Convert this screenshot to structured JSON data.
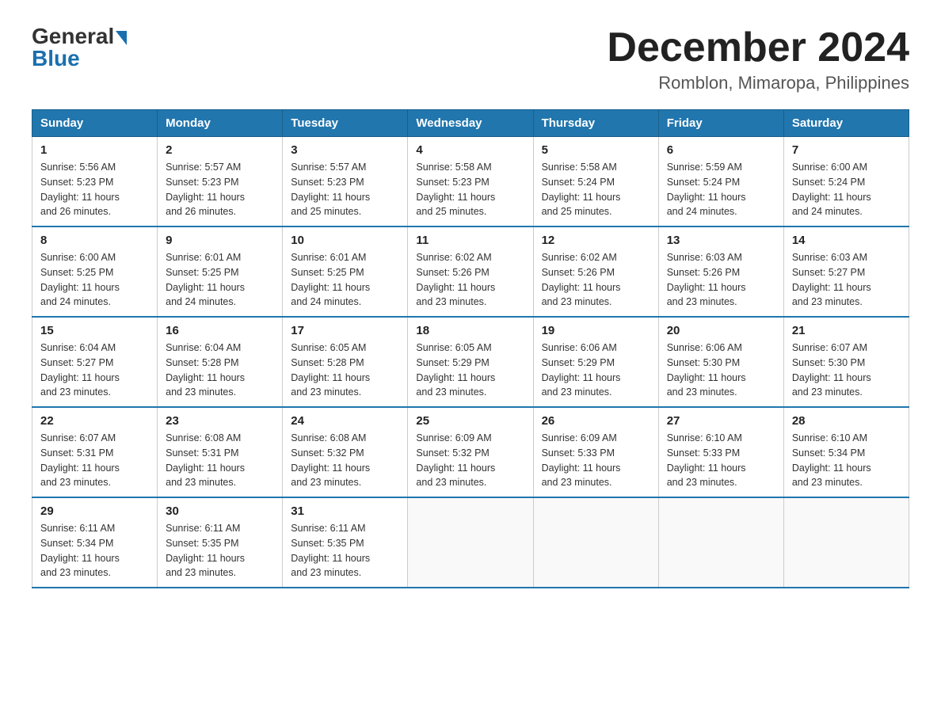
{
  "header": {
    "logo_general": "General",
    "logo_blue": "Blue",
    "month_title": "December 2024",
    "location": "Romblon, Mimaropa, Philippines"
  },
  "weekdays": [
    "Sunday",
    "Monday",
    "Tuesday",
    "Wednesday",
    "Thursday",
    "Friday",
    "Saturday"
  ],
  "weeks": [
    [
      {
        "day": "1",
        "sunrise": "5:56 AM",
        "sunset": "5:23 PM",
        "daylight": "11 hours and 26 minutes."
      },
      {
        "day": "2",
        "sunrise": "5:57 AM",
        "sunset": "5:23 PM",
        "daylight": "11 hours and 26 minutes."
      },
      {
        "day": "3",
        "sunrise": "5:57 AM",
        "sunset": "5:23 PM",
        "daylight": "11 hours and 25 minutes."
      },
      {
        "day": "4",
        "sunrise": "5:58 AM",
        "sunset": "5:23 PM",
        "daylight": "11 hours and 25 minutes."
      },
      {
        "day": "5",
        "sunrise": "5:58 AM",
        "sunset": "5:24 PM",
        "daylight": "11 hours and 25 minutes."
      },
      {
        "day": "6",
        "sunrise": "5:59 AM",
        "sunset": "5:24 PM",
        "daylight": "11 hours and 24 minutes."
      },
      {
        "day": "7",
        "sunrise": "6:00 AM",
        "sunset": "5:24 PM",
        "daylight": "11 hours and 24 minutes."
      }
    ],
    [
      {
        "day": "8",
        "sunrise": "6:00 AM",
        "sunset": "5:25 PM",
        "daylight": "11 hours and 24 minutes."
      },
      {
        "day": "9",
        "sunrise": "6:01 AM",
        "sunset": "5:25 PM",
        "daylight": "11 hours and 24 minutes."
      },
      {
        "day": "10",
        "sunrise": "6:01 AM",
        "sunset": "5:25 PM",
        "daylight": "11 hours and 24 minutes."
      },
      {
        "day": "11",
        "sunrise": "6:02 AM",
        "sunset": "5:26 PM",
        "daylight": "11 hours and 23 minutes."
      },
      {
        "day": "12",
        "sunrise": "6:02 AM",
        "sunset": "5:26 PM",
        "daylight": "11 hours and 23 minutes."
      },
      {
        "day": "13",
        "sunrise": "6:03 AM",
        "sunset": "5:26 PM",
        "daylight": "11 hours and 23 minutes."
      },
      {
        "day": "14",
        "sunrise": "6:03 AM",
        "sunset": "5:27 PM",
        "daylight": "11 hours and 23 minutes."
      }
    ],
    [
      {
        "day": "15",
        "sunrise": "6:04 AM",
        "sunset": "5:27 PM",
        "daylight": "11 hours and 23 minutes."
      },
      {
        "day": "16",
        "sunrise": "6:04 AM",
        "sunset": "5:28 PM",
        "daylight": "11 hours and 23 minutes."
      },
      {
        "day": "17",
        "sunrise": "6:05 AM",
        "sunset": "5:28 PM",
        "daylight": "11 hours and 23 minutes."
      },
      {
        "day": "18",
        "sunrise": "6:05 AM",
        "sunset": "5:29 PM",
        "daylight": "11 hours and 23 minutes."
      },
      {
        "day": "19",
        "sunrise": "6:06 AM",
        "sunset": "5:29 PM",
        "daylight": "11 hours and 23 minutes."
      },
      {
        "day": "20",
        "sunrise": "6:06 AM",
        "sunset": "5:30 PM",
        "daylight": "11 hours and 23 minutes."
      },
      {
        "day": "21",
        "sunrise": "6:07 AM",
        "sunset": "5:30 PM",
        "daylight": "11 hours and 23 minutes."
      }
    ],
    [
      {
        "day": "22",
        "sunrise": "6:07 AM",
        "sunset": "5:31 PM",
        "daylight": "11 hours and 23 minutes."
      },
      {
        "day": "23",
        "sunrise": "6:08 AM",
        "sunset": "5:31 PM",
        "daylight": "11 hours and 23 minutes."
      },
      {
        "day": "24",
        "sunrise": "6:08 AM",
        "sunset": "5:32 PM",
        "daylight": "11 hours and 23 minutes."
      },
      {
        "day": "25",
        "sunrise": "6:09 AM",
        "sunset": "5:32 PM",
        "daylight": "11 hours and 23 minutes."
      },
      {
        "day": "26",
        "sunrise": "6:09 AM",
        "sunset": "5:33 PM",
        "daylight": "11 hours and 23 minutes."
      },
      {
        "day": "27",
        "sunrise": "6:10 AM",
        "sunset": "5:33 PM",
        "daylight": "11 hours and 23 minutes."
      },
      {
        "day": "28",
        "sunrise": "6:10 AM",
        "sunset": "5:34 PM",
        "daylight": "11 hours and 23 minutes."
      }
    ],
    [
      {
        "day": "29",
        "sunrise": "6:11 AM",
        "sunset": "5:34 PM",
        "daylight": "11 hours and 23 minutes."
      },
      {
        "day": "30",
        "sunrise": "6:11 AM",
        "sunset": "5:35 PM",
        "daylight": "11 hours and 23 minutes."
      },
      {
        "day": "31",
        "sunrise": "6:11 AM",
        "sunset": "5:35 PM",
        "daylight": "11 hours and 23 minutes."
      },
      null,
      null,
      null,
      null
    ]
  ],
  "labels": {
    "sunrise": "Sunrise:",
    "sunset": "Sunset:",
    "daylight": "Daylight:"
  }
}
